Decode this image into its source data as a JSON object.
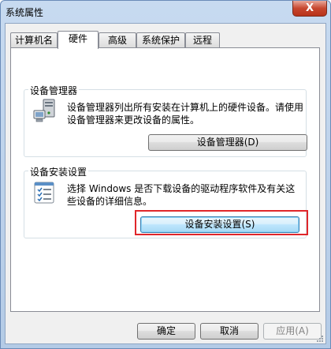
{
  "window": {
    "title": "系统属性",
    "close_label": "X"
  },
  "tabs": [
    {
      "label": "计算机名"
    },
    {
      "label": "硬件",
      "active": true
    },
    {
      "label": "高级"
    },
    {
      "label": "系统保护"
    },
    {
      "label": "远程"
    }
  ],
  "device_manager": {
    "title": "设备管理器",
    "description": "设备管理器列出所有安装在计算机上的硬件设备。请使用设备管理器来更改设备的属性。",
    "button_label": "设备管理器(D)",
    "icon": "device-manager-icon"
  },
  "device_install": {
    "title": "设备安装设置",
    "description": "选择 Windows 是否下载设备的驱动程序软件及有关这些设备的详细信息。",
    "button_label": "设备安装设置(S)",
    "icon": "checklist-icon"
  },
  "footer": {
    "ok_label": "确定",
    "cancel_label": "取消",
    "apply_label": "应用(A)"
  },
  "colors": {
    "highlight": "#e0262a",
    "close_button": "#c7472f"
  }
}
